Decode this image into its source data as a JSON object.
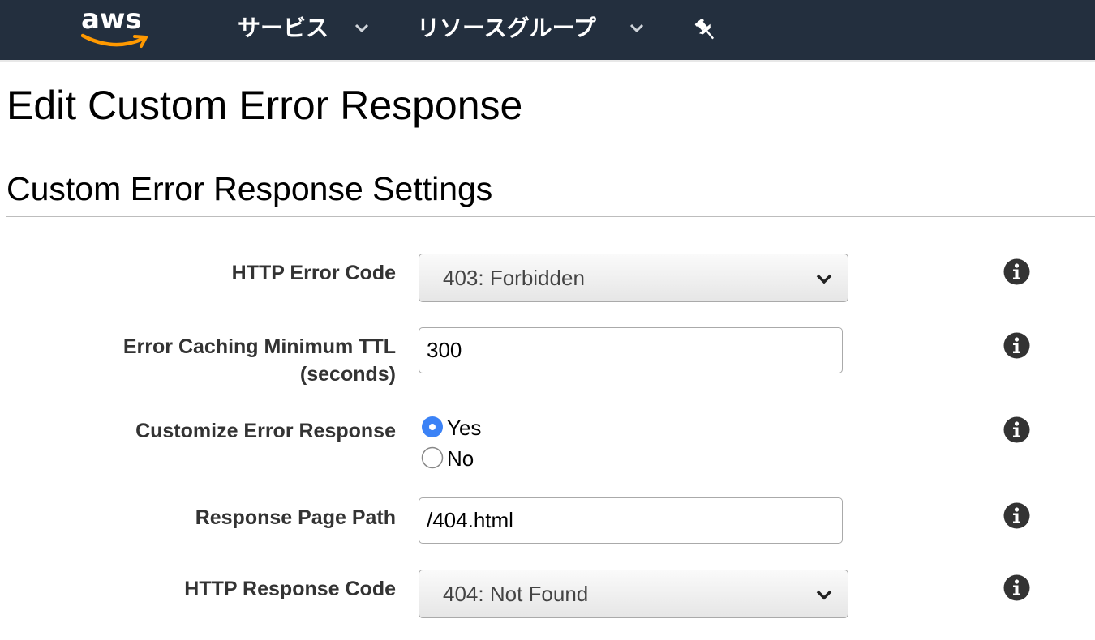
{
  "topbar": {
    "logo_text": "aws",
    "nav": [
      {
        "label": "サービス"
      },
      {
        "label": "リソースグループ"
      }
    ]
  },
  "page": {
    "title": "Edit Custom Error Response",
    "section_title": "Custom Error Response Settings"
  },
  "form": {
    "http_error_code": {
      "label": "HTTP Error Code",
      "value": "403: Forbidden"
    },
    "ttl": {
      "label_line1": "Error Caching Minimum TTL",
      "label_line2": "(seconds)",
      "value": "300"
    },
    "customize": {
      "label": "Customize Error Response",
      "yes": "Yes",
      "no": "No",
      "selected": "Yes"
    },
    "page_path": {
      "label": "Response Page Path",
      "value": "/404.html"
    },
    "http_response_code": {
      "label": "HTTP Response Code",
      "value": "404: Not Found"
    }
  },
  "colors": {
    "topbar_bg": "#232f3e",
    "aws_orange": "#ff9900",
    "radio_selected": "#3b82f6"
  }
}
